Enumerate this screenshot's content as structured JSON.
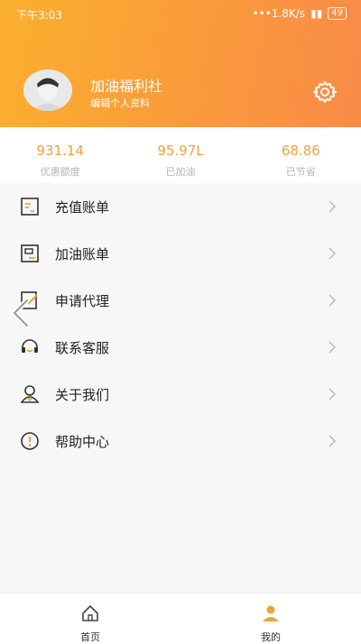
{
  "status_bar": {
    "time": "下午3:03",
    "network_speed": "•••1.8K/s",
    "battery": "49"
  },
  "profile": {
    "name": "加油福利社",
    "edit_label": "编辑个人资料"
  },
  "stats": [
    {
      "value": "931.14",
      "label": "优惠额度"
    },
    {
      "value": "95.97L",
      "label": "已加油"
    },
    {
      "value": "68.86",
      "label": "已节省"
    }
  ],
  "menu": [
    {
      "label": "充值账单",
      "icon": "bill-icon"
    },
    {
      "label": "加油账单",
      "icon": "fuel-bill-icon"
    },
    {
      "label": "申请代理",
      "icon": "edit-icon"
    },
    {
      "label": "联系客服",
      "icon": "headset-icon"
    },
    {
      "label": "关于我们",
      "icon": "person-icon"
    },
    {
      "label": "帮助中心",
      "icon": "info-icon"
    }
  ],
  "tabs": [
    {
      "label": "首页",
      "icon": "home-icon"
    },
    {
      "label": "我的",
      "icon": "user-icon"
    }
  ],
  "colors": {
    "accent": "#f0a23b",
    "header_start": "#fbb02d",
    "header_end": "#f98a48"
  }
}
